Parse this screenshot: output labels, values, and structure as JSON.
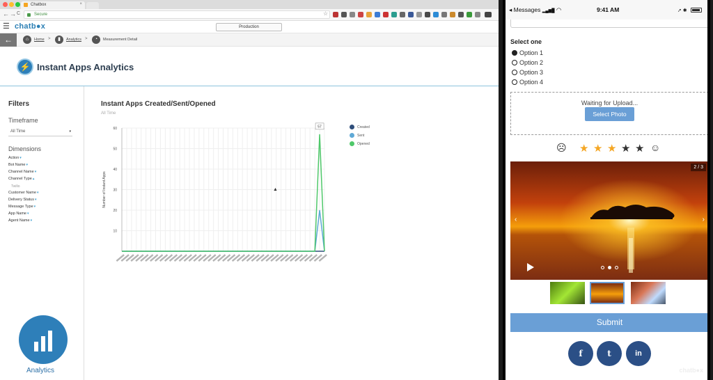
{
  "browser": {
    "tab_title": "Chatbox",
    "tab_close": "×",
    "url_text": "Secure",
    "back_glyph": "←",
    "forward_glyph": "→",
    "reload_glyph": "C",
    "star_glyph": "☆"
  },
  "header": {
    "menu_glyph": "☰",
    "logo": "chatb●x",
    "environment": "Production"
  },
  "breadcrumb": {
    "back_glyph": "←",
    "home": "Home",
    "analytics": "Analytics",
    "detail": "Measurement Detail",
    "separator": ">"
  },
  "page": {
    "title": "Instant Apps Analytics",
    "icon_glyph": "⚡"
  },
  "sidebar": {
    "filters_heading": "Filters",
    "timeframe_heading": "Timeframe",
    "timeframe_value": "All Time",
    "caret": "▾",
    "dimensions_heading": "Dimensions",
    "dimensions": [
      {
        "label": "Action",
        "chev": "▾"
      },
      {
        "label": "Bot Name",
        "chev": "▾"
      },
      {
        "label": "Channel Name",
        "chev": "▾"
      },
      {
        "label": "Channel Type",
        "chev": "▴"
      },
      {
        "label": "Customer Name",
        "chev": "▾"
      },
      {
        "label": "Delivery Status",
        "chev": "▾"
      },
      {
        "label": "Message Type",
        "chev": "▾"
      },
      {
        "label": "App Name",
        "chev": "▾"
      },
      {
        "label": "Agent Name",
        "chev": "▾"
      }
    ],
    "channel_type_sub": "Twilio",
    "nav_label": "Analytics"
  },
  "chart_data": {
    "type": "line",
    "title": "Instant Apps Created/Sent/Opened",
    "subtitle": "All Time",
    "xlabel": "",
    "ylabel": "Number of Instant Apps",
    "ylim": [
      0,
      60
    ],
    "yticks": [
      10,
      20,
      30,
      40,
      50,
      60
    ],
    "point_count": 43,
    "series": [
      {
        "name": "Created",
        "color": "#2f4e7a",
        "values": [
          0,
          0,
          0,
          0,
          0,
          0,
          0,
          0,
          0,
          0,
          0,
          0,
          0,
          0,
          0,
          0,
          0,
          0,
          0,
          0,
          0,
          0,
          0,
          0,
          0,
          0,
          0,
          0,
          0,
          0,
          0,
          0,
          0,
          0,
          0,
          0,
          0,
          0,
          0,
          0,
          0,
          0,
          0
        ]
      },
      {
        "name": "Sent",
        "color": "#5fa9d6",
        "values": [
          0,
          0,
          0,
          0,
          0,
          0,
          0,
          0,
          0,
          0,
          0,
          0,
          0,
          0,
          0,
          0,
          0,
          0,
          0,
          0,
          0,
          0,
          0,
          0,
          0,
          0,
          0,
          0,
          0,
          0,
          0,
          0,
          0,
          0,
          0,
          0,
          0,
          0,
          0,
          0,
          0,
          20,
          0
        ]
      },
      {
        "name": "Opened",
        "color": "#4fc86a",
        "values": [
          0,
          0,
          0,
          0,
          0,
          0,
          0,
          0,
          0,
          0,
          0,
          0,
          0,
          0,
          0,
          0,
          0,
          0,
          0,
          0,
          0,
          0,
          0,
          0,
          0,
          0,
          0,
          0,
          0,
          0,
          0,
          0,
          0,
          0,
          0,
          0,
          0,
          0,
          0,
          0,
          0,
          57,
          0
        ]
      }
    ],
    "tooltip": "57",
    "legend": "right",
    "grid": true
  },
  "cursor_glyph": "▲",
  "phone": {
    "status": {
      "carrier": "◂ Messages",
      "signal": "▂▄▆█",
      "wifi": "◠",
      "time": "9:41 AM",
      "right": "➚ ✱"
    },
    "select_one": "Select one",
    "options": [
      {
        "label": "Option 1",
        "checked": true
      },
      {
        "label": "Option 2",
        "checked": false
      },
      {
        "label": "Option 3",
        "checked": false
      },
      {
        "label": "Option 4",
        "checked": false
      }
    ],
    "upload_text": "Waiting for Upload...",
    "select_photo": "Select Photo",
    "sad_face": "☹",
    "happy_face": "☺",
    "rating": 3,
    "rating_max": 5,
    "star_glyph": "★",
    "star_on_color": "#f5a623",
    "star_off_color": "#333333",
    "carousel_counter": "2 / 3",
    "carousel_prev": "‹",
    "carousel_next": "›",
    "carousel_index": 2,
    "carousel_total": 3,
    "submit": "Submit",
    "social": {
      "facebook": "f",
      "twitter": "t",
      "linkedin": "in"
    },
    "watermark": "chatb●x"
  }
}
